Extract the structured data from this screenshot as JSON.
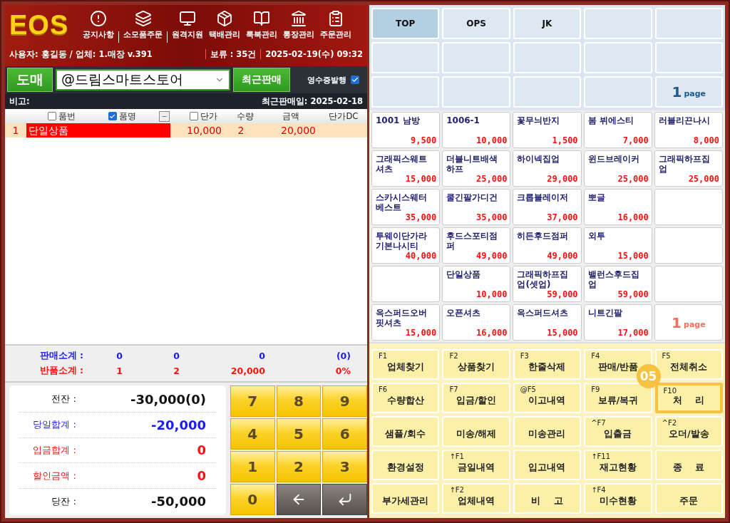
{
  "header": {
    "logo": "EOS",
    "menu": [
      {
        "label": "공지사항",
        "kind": "notice",
        "separator_after": true
      },
      {
        "label": "소모품주문",
        "kind": "layers",
        "separator_after": true
      },
      {
        "label": "원격지원",
        "kind": "monitor",
        "separator_after": false
      },
      {
        "label": "택배관리",
        "kind": "box",
        "separator_after": false
      },
      {
        "label": "룩북관리",
        "kind": "book",
        "separator_after": false
      },
      {
        "label": "통장관리",
        "kind": "bank",
        "separator_after": false
      },
      {
        "label": "주문관리",
        "kind": "clipboard",
        "separator_after": false
      }
    ],
    "user_info": "사용자: 홍길동 / 업체: 1.매장 v.391",
    "hold": "보류 : 35건",
    "datetime": "2025-02-19(수) 09:32"
  },
  "action_bar": {
    "mode_button": "도매",
    "customer_select": "@드림스마트스토어",
    "recent_button": "최근판매",
    "receipt": {
      "label": "영수증발행",
      "checked": true
    }
  },
  "note_bar": {
    "label": "비고:",
    "last_sale": "최근판매일: 2025-02-18"
  },
  "table": {
    "columns": [
      {
        "kind": "check",
        "label": "품번",
        "checked": false
      },
      {
        "kind": "check",
        "label": "품명",
        "checked": true
      },
      {
        "kind": "toggle"
      },
      {
        "kind": "check",
        "label": "단가",
        "checked": false
      },
      {
        "kind": "plain",
        "label": "수량"
      },
      {
        "kind": "plain",
        "label": "금액"
      },
      {
        "kind": "plain",
        "label": "단가DC"
      }
    ],
    "rows": [
      {
        "no": "1",
        "name": "단일상품",
        "price": "10,000",
        "qty": "2",
        "amount": "20,000",
        "selected": true
      }
    ]
  },
  "summary": [
    {
      "label": "판매소계 :",
      "color": "#1a1aff",
      "values": [
        "0",
        "0",
        "0",
        "(0)"
      ]
    },
    {
      "label": "반품소계 :",
      "color": "#ff1010",
      "values": [
        "1",
        "2",
        "20,000",
        "0%"
      ]
    }
  ],
  "balance": [
    {
      "label": "전잔 :",
      "value": "-30,000(0)",
      "color": "#111111"
    },
    {
      "label": "당일합계 :",
      "value": "-20,000",
      "color": "#1a1aff"
    },
    {
      "label": "입금합계 :",
      "value": "0",
      "color": "#ff1010"
    },
    {
      "label": "할인금액 :",
      "value": "0",
      "color": "#ff1010"
    },
    {
      "label": "당잔 :",
      "value": "-50,000",
      "color": "#111111"
    }
  ],
  "keypad": [
    {
      "kind": "digit",
      "label": "7"
    },
    {
      "kind": "digit",
      "label": "8"
    },
    {
      "kind": "digit",
      "label": "9"
    },
    {
      "kind": "digit",
      "label": "4"
    },
    {
      "kind": "digit",
      "label": "5"
    },
    {
      "kind": "digit",
      "label": "6"
    },
    {
      "kind": "digit",
      "label": "1"
    },
    {
      "kind": "digit",
      "label": "2"
    },
    {
      "kind": "digit",
      "label": "3"
    },
    {
      "kind": "digit",
      "label": "0"
    },
    {
      "kind": "backspace"
    },
    {
      "kind": "enter"
    }
  ],
  "categories": {
    "items": [
      {
        "label": "TOP",
        "selected": true
      },
      {
        "label": "OPS",
        "selected": false
      },
      {
        "label": "JK",
        "selected": false
      }
    ],
    "page": {
      "number": "1",
      "unit": "page"
    }
  },
  "products": [
    {
      "kind": "product",
      "name": "1001 남방",
      "price": "9,500"
    },
    {
      "kind": "product",
      "name": "1006-1",
      "price": "10,000"
    },
    {
      "kind": "product",
      "name": "꽃무늬반지",
      "price": "1,500"
    },
    {
      "kind": "product",
      "name": "봄 뷔에스티",
      "price": "7,000"
    },
    {
      "kind": "product",
      "name": "러블리끈나시",
      "price": "8,000"
    },
    {
      "kind": "product",
      "name": "그래픽스웨트셔츠",
      "price": "15,000"
    },
    {
      "kind": "product",
      "name": "더블니트배색하프",
      "price": "25,000"
    },
    {
      "kind": "product",
      "name": "하이넥집업",
      "price": "29,000"
    },
    {
      "kind": "product",
      "name": "윈드브레이커",
      "price": "25,000"
    },
    {
      "kind": "product",
      "name": "그래픽하프집업",
      "price": "25,000"
    },
    {
      "kind": "product",
      "name": "스카시스웨터베스트",
      "price": "35,000"
    },
    {
      "kind": "product",
      "name": "쿨긴팔가디건",
      "price": "35,000"
    },
    {
      "kind": "product",
      "name": "크롭블레이저",
      "price": "37,000"
    },
    {
      "kind": "product",
      "name": "뽀글",
      "price": "16,000"
    },
    {
      "kind": "empty"
    },
    {
      "kind": "product",
      "name": "투웨이단가라 기본나시티",
      "price": "40,000"
    },
    {
      "kind": "product",
      "name": "후드스포티점퍼",
      "price": "49,000"
    },
    {
      "kind": "product",
      "name": "히든후드점퍼",
      "price": "49,000"
    },
    {
      "kind": "product",
      "name": "외투",
      "price": "15,000"
    },
    {
      "kind": "empty"
    },
    {
      "kind": "empty"
    },
    {
      "kind": "product",
      "name": "단일상품",
      "price": "10,000"
    },
    {
      "kind": "product",
      "name": "그래픽하프집업(셋업)",
      "price": "59,000"
    },
    {
      "kind": "product",
      "name": "밸런스후드집업",
      "price": "59,000"
    },
    {
      "kind": "empty"
    },
    {
      "kind": "product",
      "name": "옥스퍼드오버핏셔츠",
      "price": "15,000"
    },
    {
      "kind": "product",
      "name": "오픈셔츠",
      "price": "16,000"
    },
    {
      "kind": "product",
      "name": "옥스퍼드셔츠",
      "price": "15,000"
    },
    {
      "kind": "product",
      "name": "니트긴팔",
      "price": "17,000"
    },
    {
      "kind": "page",
      "number": "1",
      "unit": "page"
    }
  ],
  "functions": [
    {
      "key": "F1",
      "label": "업체찾기",
      "highlighted": false
    },
    {
      "key": "F2",
      "label": "상품찾기",
      "highlighted": false
    },
    {
      "key": "F3",
      "label": "한줄삭제",
      "highlighted": false
    },
    {
      "key": "F4",
      "label": "판매/반품",
      "highlighted": false
    },
    {
      "key": "F5",
      "label": "전체취소",
      "highlighted": false
    },
    {
      "key": "F6",
      "label": "수량합산",
      "highlighted": false
    },
    {
      "key": "F7",
      "label": "입금/할인",
      "highlighted": false
    },
    {
      "key": "@F5",
      "label": "이고내역",
      "highlighted": false
    },
    {
      "key": "F9",
      "label": "보류/복귀",
      "highlighted": false
    },
    {
      "key": "F10",
      "label": "처    리",
      "highlighted": true,
      "callout": "05"
    },
    {
      "label": "샘플/회수",
      "highlighted": false
    },
    {
      "label": "미송/해제",
      "highlighted": false
    },
    {
      "label": "미송관리",
      "highlighted": false
    },
    {
      "key": "^F7",
      "label": "입출금",
      "highlighted": false
    },
    {
      "key": "^F2",
      "label": "오더/발송",
      "highlighted": false
    },
    {
      "label": "환경설정",
      "highlighted": false
    },
    {
      "key": "↑F1",
      "label": "금일내역",
      "highlighted": false
    },
    {
      "label": "입고내역",
      "highlighted": false
    },
    {
      "key": "↑F11",
      "label": "재고현황",
      "highlighted": false
    },
    {
      "label": "종    료",
      "highlighted": false
    },
    {
      "label": "부가세관리",
      "highlighted": false
    },
    {
      "key": "↑F2",
      "label": "업체내역",
      "highlighted": false
    },
    {
      "label": "비    고",
      "highlighted": false
    },
    {
      "key": "↑F4",
      "label": "미수현황",
      "highlighted": false
    },
    {
      "label": "주문",
      "highlighted": false
    }
  ]
}
